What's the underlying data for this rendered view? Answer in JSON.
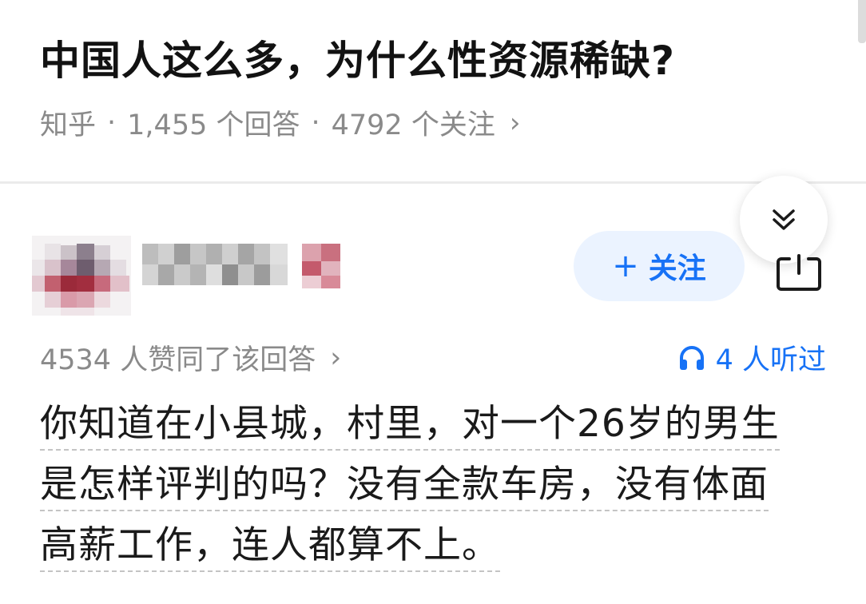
{
  "question": {
    "title": "中国人这么多，为什么性资源稀缺?",
    "source": "知乎",
    "separator": "·",
    "answer_count": "1,455 个回答",
    "follower_count": "4792 个关注",
    "chevron": "›"
  },
  "author": {
    "follow_label": "关注",
    "follow_plus": "+"
  },
  "answer": {
    "votes": "4534 人赞同了该回答",
    "votes_chevron": "›",
    "listen_label": "4 人听过",
    "lines": [
      "你知道在小县城，村里，对一个26岁的男生",
      "是怎样评判的吗？没有全款车房，没有体面",
      "高薪工作，连人都算不上。"
    ]
  },
  "icons": {
    "collapse": "double-chevron-down-icon",
    "share": "share-icon",
    "listen": "headphones-icon"
  },
  "colors": {
    "accent": "#1772f6",
    "follow_bg": "#ebf3ff",
    "muted_text": "#8a8a8a",
    "title_text": "#121212"
  }
}
